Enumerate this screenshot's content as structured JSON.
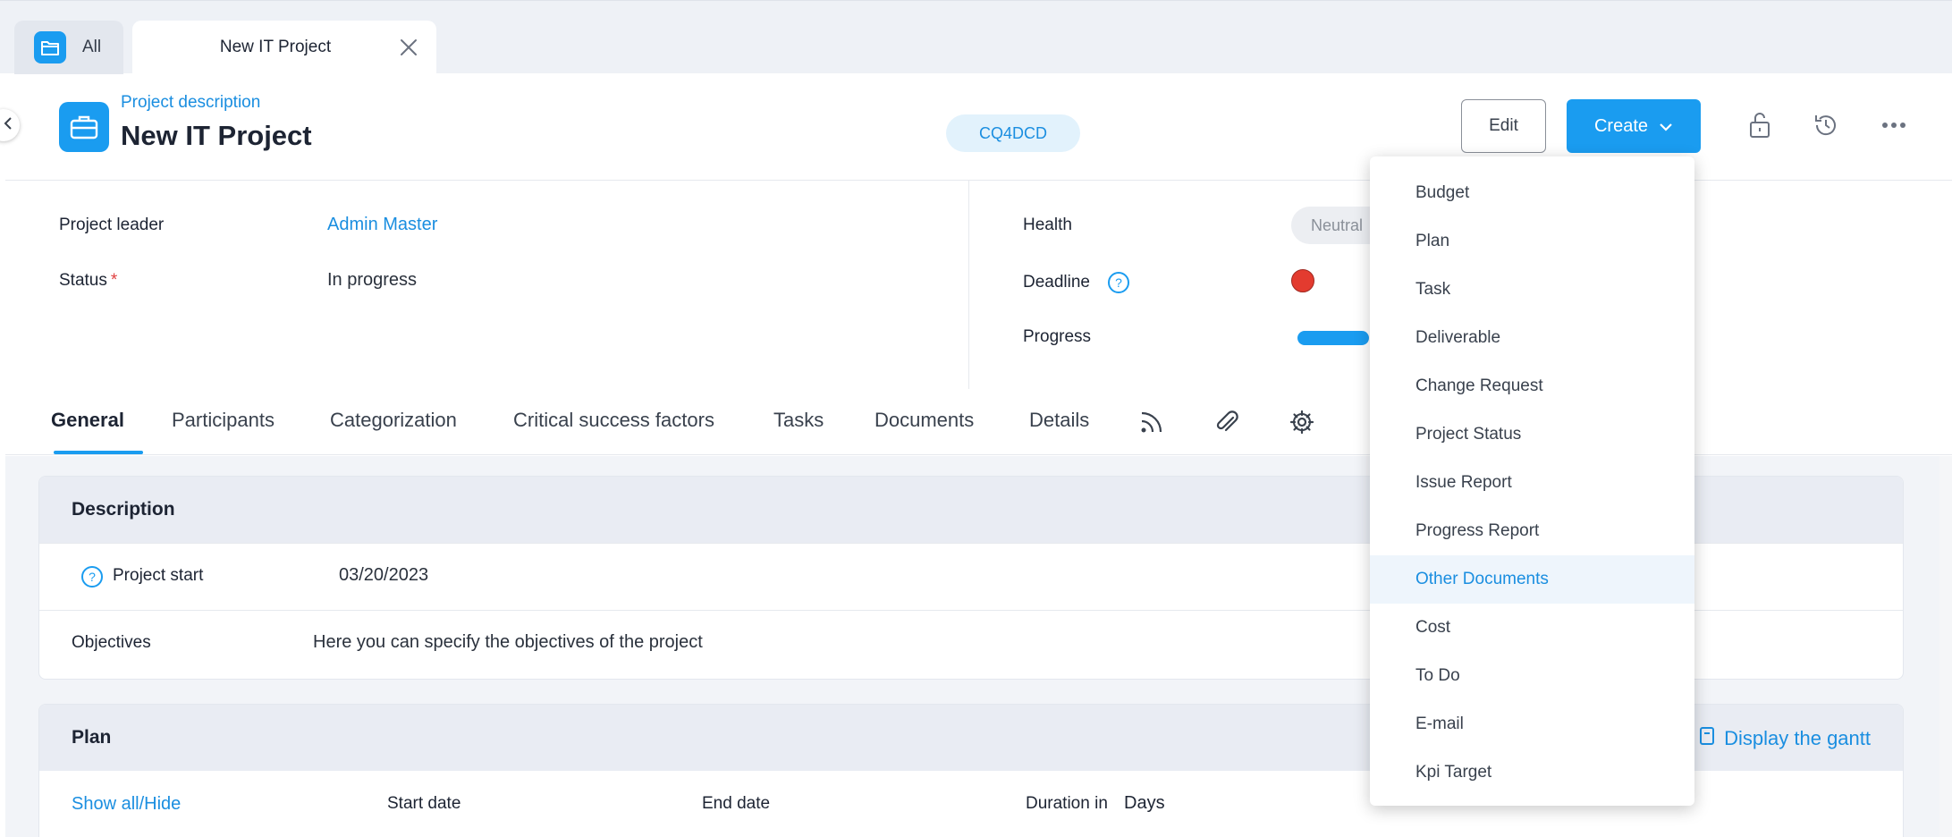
{
  "tabs": {
    "all_label": "All",
    "active_label": "New IT Project"
  },
  "header": {
    "subtitle": "Project description",
    "title": "New IT Project",
    "code": "CQ4DCD",
    "edit_label": "Edit",
    "create_label": "Create"
  },
  "info": {
    "leader_label": "Project leader",
    "leader_value": "Admin Master",
    "status_label": "Status",
    "status_required": "*",
    "status_value": "In progress",
    "health_label": "Health",
    "health_value": "Neutral",
    "deadline_label": "Deadline",
    "deadline_color": "#e33b2f",
    "progress_label": "Progress"
  },
  "section_tabs": [
    "General",
    "Participants",
    "Categorization",
    "Critical success factors",
    "Tasks",
    "Documents",
    "Details"
  ],
  "section_icons": [
    "rss-icon",
    "paperclip-icon",
    "gear-icon"
  ],
  "description_card": {
    "title": "Description",
    "project_start_label": "Project start",
    "project_start_value": "03/20/2023",
    "objectives_label": "Objectives",
    "objectives_value": "Here you can specify the objectives of the project"
  },
  "plan_card": {
    "title": "Plan",
    "gantt_link": "Display the gantt",
    "show_hide": "Show all/Hide",
    "start_date": "Start date",
    "end_date": "End date",
    "duration_label": "Duration in",
    "duration_unit": "Days"
  },
  "create_menu": {
    "items": [
      "Budget",
      "Plan",
      "Task",
      "Deliverable",
      "Change Request",
      "Project Status",
      "Issue Report",
      "Progress Report",
      "Other Documents",
      "Cost",
      "To Do",
      "E-mail",
      "Kpi Target"
    ],
    "highlighted": "Other Documents"
  },
  "colors": {
    "accent": "#1a9cf0",
    "link": "#1a8ee0",
    "danger": "#e33b2f"
  }
}
